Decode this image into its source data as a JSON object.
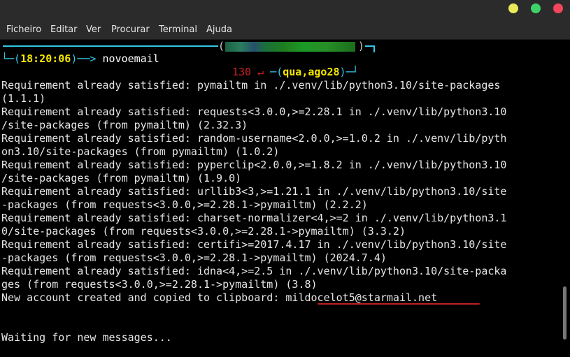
{
  "window": {
    "buttons": [
      "minimize",
      "maximize",
      "close"
    ]
  },
  "menu": [
    "Ficheiro",
    "Editar",
    "Ver",
    "Procurar",
    "Terminal",
    "Ajuda"
  ],
  "prompt": {
    "time": "18:20:06",
    "command": "novoemail",
    "exit_code": "130",
    "return_symbol": "↵",
    "date": "qua,ago28"
  },
  "output": [
    "Requirement already satisfied: pymailtm in ./.venv/lib/python3.10/site-packages",
    "(1.1.1)",
    "Requirement already satisfied: requests<3.0.0,>=2.28.1 in ./.venv/lib/python3.10",
    "/site-packages (from pymailtm) (2.32.3)",
    "Requirement already satisfied: random-username<2.0.0,>=1.0.2 in ./.venv/lib/pyth",
    "on3.10/site-packages (from pymailtm) (1.0.2)",
    "Requirement already satisfied: pyperclip<2.0.0,>=1.8.2 in ./.venv/lib/python3.10",
    "/site-packages (from pymailtm) (1.9.0)",
    "Requirement already satisfied: urllib3<3,>=1.21.1 in ./.venv/lib/python3.10/site",
    "-packages (from requests<3.0.0,>=2.28.1->pymailtm) (2.2.2)",
    "Requirement already satisfied: charset-normalizer<4,>=2 in ./.venv/lib/python3.1",
    "0/site-packages (from requests<3.0.0,>=2.28.1->pymailtm) (3.3.2)",
    "Requirement already satisfied: certifi>=2017.4.17 in ./.venv/lib/python3.10/site",
    "-packages (from requests<3.0.0,>=2.28.1->pymailtm) (2024.7.4)",
    "Requirement already satisfied: idna<4,>=2.5 in ./.venv/lib/python3.10/site-packa",
    "ges (from requests<3.0.0,>=2.28.1->pymailtm) (3.8)"
  ],
  "account_line": {
    "prefix": "New account created and copied to clipboard: ",
    "email": "mildocelot5@starmail.net"
  },
  "waiting": "Waiting for new messages...",
  "colors": {
    "prompt_accent": "#33c7e6",
    "time_and_date": "#f3e600",
    "exit_code": "#cc2222",
    "email_underline": "#c02020"
  }
}
